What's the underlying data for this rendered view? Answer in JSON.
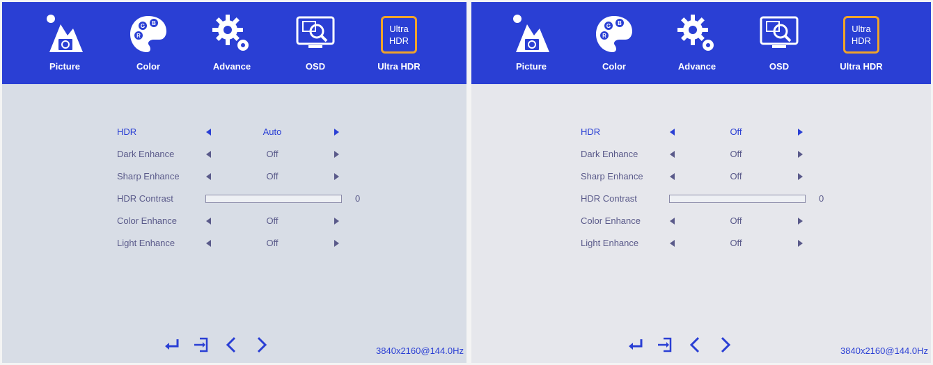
{
  "tabs": [
    {
      "label": "Picture"
    },
    {
      "label": "Color"
    },
    {
      "label": "Advance"
    },
    {
      "label": "OSD"
    },
    {
      "label": "Ultra HDR",
      "box_line1": "Ultra",
      "box_line2": "HDR"
    }
  ],
  "panels": [
    {
      "menu": [
        {
          "label": "HDR",
          "value": "Auto",
          "selected": true
        },
        {
          "label": "Dark Enhance",
          "value": "Off"
        },
        {
          "label": "Sharp Enhance",
          "value": "Off"
        },
        {
          "label": "HDR Contrast",
          "slider_value": "0"
        },
        {
          "label": "Color Enhance",
          "value": "Off"
        },
        {
          "label": "Light Enhance",
          "value": "Off"
        }
      ],
      "resolution": "3840x2160@144.0Hz"
    },
    {
      "menu": [
        {
          "label": "HDR",
          "value": "Off",
          "selected": true
        },
        {
          "label": "Dark Enhance",
          "value": "Off"
        },
        {
          "label": "Sharp Enhance",
          "value": "Off"
        },
        {
          "label": "HDR Contrast",
          "slider_value": "0"
        },
        {
          "label": "Color Enhance",
          "value": "Off"
        },
        {
          "label": "Light Enhance",
          "value": "Off"
        }
      ],
      "resolution": "3840x2160@144.0Hz"
    }
  ],
  "colors": {
    "header_blue": "#2a3fd4",
    "accent_orange": "#f0a32a",
    "text": "#5a5a8a"
  },
  "footer_icons": [
    "enter-icon",
    "exit-icon",
    "chevron-left-icon",
    "chevron-right-icon"
  ]
}
